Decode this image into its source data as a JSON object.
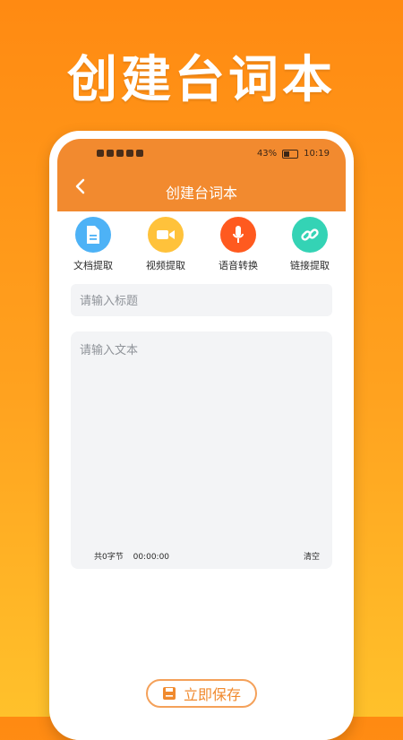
{
  "hero": {
    "title": "创建台词本"
  },
  "status_bar": {
    "battery": "43%",
    "time": "10:19"
  },
  "app_bar": {
    "title": "创建台词本"
  },
  "tools": [
    {
      "label": "文档提取",
      "color": "#4db2f6",
      "icon": "document-icon"
    },
    {
      "label": "视频提取",
      "color": "#ffc23b",
      "icon": "video-camera-icon"
    },
    {
      "label": "语音转换",
      "color": "#ff5a1f",
      "icon": "microphone-icon"
    },
    {
      "label": "链接提取",
      "color": "#34d3b5",
      "icon": "link-icon"
    }
  ],
  "form": {
    "title_placeholder": "请输入标题",
    "text_placeholder": "请输入文本",
    "char_count": "共0字节",
    "duration": "00:00:00",
    "clear_label": "清空"
  },
  "footer": {
    "save_label": "立即保存"
  },
  "colors": {
    "accent": "#f28a2f",
    "save_border": "#f4a15a"
  }
}
